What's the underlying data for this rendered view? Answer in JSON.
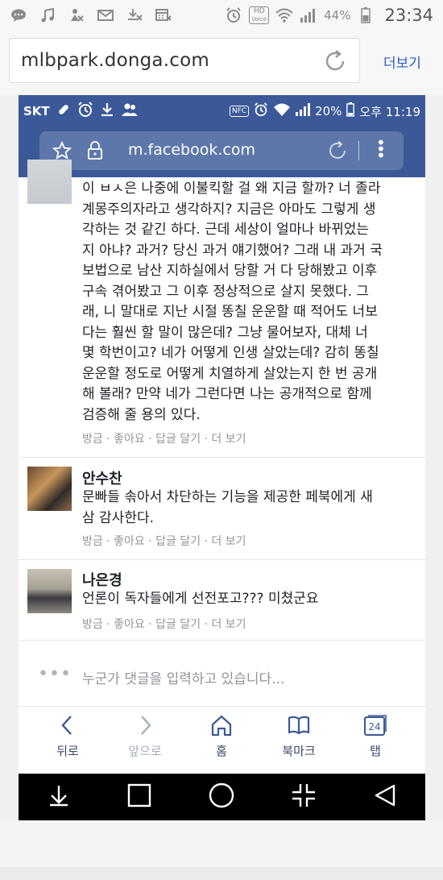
{
  "outer_status": {
    "hd_text": "HD",
    "voice_text": "Voice",
    "battery": "44%",
    "time": "23:34"
  },
  "outer_browser": {
    "url": "mlbpark.donga.com",
    "more_label": "더보기"
  },
  "inner_status": {
    "carrier": "SKT",
    "nfc": "NFC",
    "battery": "20%",
    "time": "오후 11:19"
  },
  "inner_browser": {
    "url": "m.facebook.com"
  },
  "comments": [
    {
      "name": "",
      "text": "이 ㅂㅅ은 나중에 이불킥할 걸 왜 지금 할까? 너 졸라\n계몽주의자라고 생각하지? 지금은 아마도 그렇게 생\n각하는 것 같긴 하다. 근데 세상이 얼마나 바뀌었는\n지 아냐? 과거? 당신 과거 얘기했어? 그래 내 과거 국\n보법으로 남산 지하실에서 당할 거 다 당해봤고 이후\n구속 겪어봤고 그 이후 정상적으로 살지 못했다. 그\n래, 니 말대로 지난 시절 똥칠 운운할 때 적어도 너보\n다는 훨씬 할 말이 많은데? 그냥 물어보자, 대체 너\n몇 학번이고? 네가 어떻게 인생 살았는데? 감히 똥칠\n운운할 정도로 어떻게 치열하게 살았는지 한 번 공개\n해 볼래? 만약 네가 그런다면 나는 공개적으로 함께\n검증해 줄 용의 있다.",
      "actions": "방금 · 좋아요 · 답글 달기 · 더 보기"
    },
    {
      "name": "안수찬",
      "text": "문빠들 솎아서 차단하는 기능을 제공한 페북에게 새\n삼 감사한다.",
      "actions": "방금 · 좋아요 · 답글 달기 · 더 보기"
    },
    {
      "name": "나은경",
      "text": "언론이 독자들에게 선전포고??? 미쳤군요",
      "actions": "방금 · 좋아요 · 답글 달기 · 더 보기"
    }
  ],
  "typing": {
    "dots": "•••",
    "text": "누군가 댓글을 입력하고 있습니다..."
  },
  "inner_nav": {
    "back": "뒤로",
    "forward": "앞으로",
    "home": "홈",
    "bookmarks": "북마크",
    "tabs": "탭",
    "tab_count": "24"
  },
  "colors": {
    "facebook_blue": "#3b5998",
    "link_blue": "#2c5bbf",
    "meta_gray": "#90949c"
  }
}
